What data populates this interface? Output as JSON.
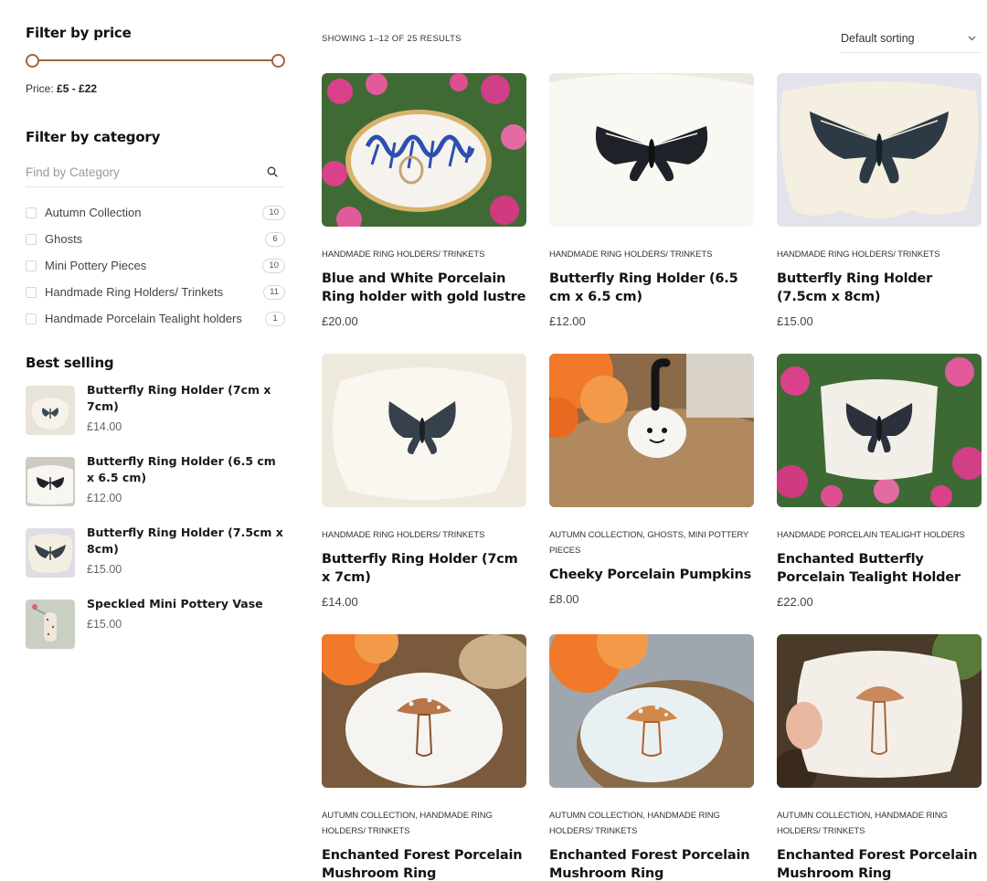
{
  "sidebar": {
    "price_filter": {
      "title": "Filter by price",
      "label": "Price:",
      "range": "£5 - £22"
    },
    "category_filter": {
      "title": "Filter by category",
      "search_placeholder": "Find by Category",
      "items": [
        {
          "label": "Autumn Collection",
          "count": "10"
        },
        {
          "label": "Ghosts",
          "count": "6"
        },
        {
          "label": "Mini Pottery Pieces",
          "count": "10"
        },
        {
          "label": "Handmade Ring Holders/ Trinkets",
          "count": "11"
        },
        {
          "label": "Handmade Porcelain Tealight holders",
          "count": "1"
        }
      ]
    },
    "best_selling": {
      "title": "Best selling",
      "items": [
        {
          "name": "Butterfly Ring Holder (7cm x 7cm)",
          "price": "£14.00"
        },
        {
          "name": "Butterfly Ring Holder (6.5 cm x 6.5 cm)",
          "price": "£12.00"
        },
        {
          "name": "Butterfly Ring Holder (7.5cm x 8cm)",
          "price": "£15.00"
        },
        {
          "name": "Speckled Mini Pottery Vase",
          "price": "£15.00"
        }
      ]
    }
  },
  "main": {
    "result_count": "SHOWING 1–12 OF 25 RESULTS",
    "sorting": "Default sorting",
    "products": [
      {
        "categories": "HANDMADE RING HOLDERS/ TRINKETS",
        "title": "Blue and White Porcelain Ring holder with gold lustre",
        "price": "£20.00"
      },
      {
        "categories": "HANDMADE RING HOLDERS/ TRINKETS",
        "title": "Butterfly Ring Holder (6.5 cm x 6.5 cm)",
        "price": "£12.00"
      },
      {
        "categories": "HANDMADE RING HOLDERS/ TRINKETS",
        "title": "Butterfly Ring Holder (7.5cm x 8cm)",
        "price": "£15.00"
      },
      {
        "categories": "HANDMADE RING HOLDERS/ TRINKETS",
        "title": "Butterfly Ring Holder (7cm x 7cm)",
        "price": "£14.00"
      },
      {
        "categories": "AUTUMN COLLECTION, GHOSTS, MINI POTTERY PIECES",
        "title": "Cheeky Porcelain Pumpkins",
        "price": "£8.00"
      },
      {
        "categories": "HANDMADE PORCELAIN TEALIGHT HOLDERS",
        "title": "Enchanted Butterfly Porcelain Tealight Holder",
        "price": "£22.00"
      },
      {
        "categories": "AUTUMN COLLECTION, HANDMADE RING HOLDERS/ TRINKETS",
        "title": "Enchanted Forest Porcelain Mushroom Ring",
        "price": ""
      },
      {
        "categories": "AUTUMN COLLECTION, HANDMADE RING HOLDERS/ TRINKETS",
        "title": "Enchanted Forest Porcelain Mushroom Ring",
        "price": ""
      },
      {
        "categories": "AUTUMN COLLECTION, HANDMADE RING HOLDERS/ TRINKETS",
        "title": "Enchanted Forest Porcelain Mushroom Ring",
        "price": ""
      }
    ]
  },
  "colors": {
    "accent": "#a3643d",
    "text_dark": "#141414",
    "text_muted": "#666666",
    "border": "#e4e4e4"
  }
}
